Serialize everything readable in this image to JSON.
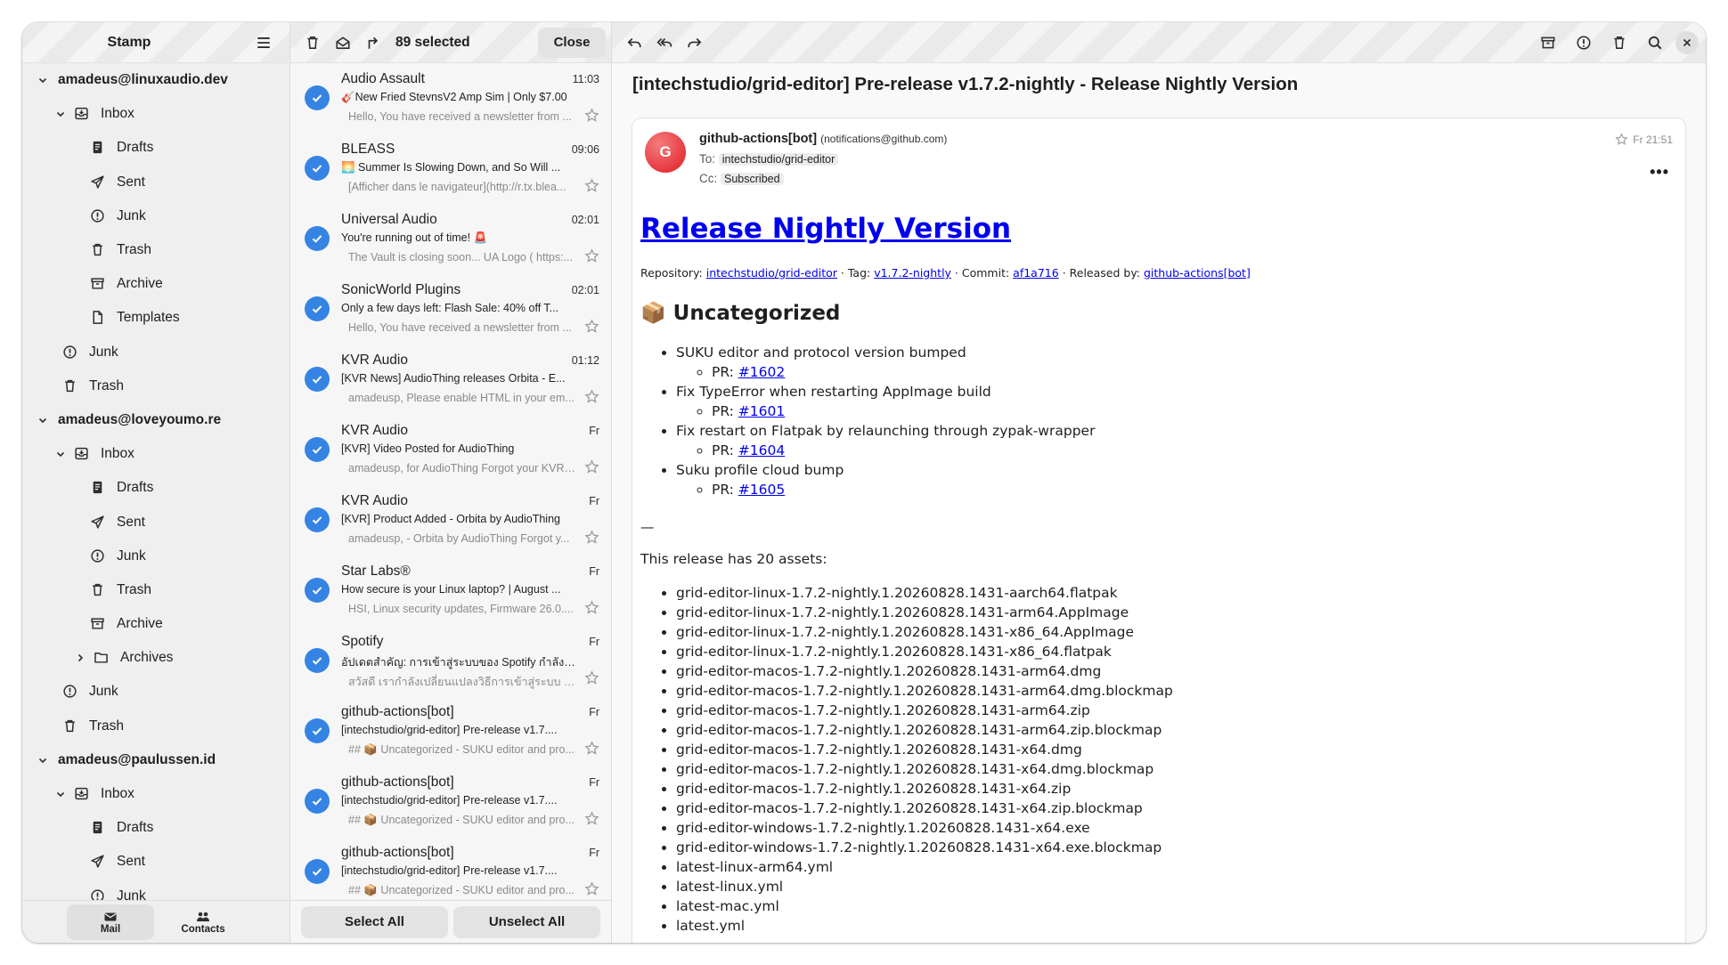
{
  "sidebar": {
    "title": "Stamp",
    "accounts": [
      {
        "name": "amadeus@linuxaudio.dev",
        "inbox_label": "Inbox",
        "subfolders": [
          "Drafts",
          "Sent",
          "Junk",
          "Trash",
          "Archive",
          "Templates"
        ],
        "extra_folders": [
          "Junk",
          "Trash"
        ]
      },
      {
        "name": "amadeus@loveyoumo.re",
        "inbox_label": "Inbox",
        "subfolders": [
          "Drafts",
          "Sent",
          "Junk",
          "Trash",
          "Archive",
          "Archives"
        ],
        "extra_folders": [
          "Junk",
          "Trash"
        ]
      },
      {
        "name": "amadeus@paulussen.id",
        "inbox_label": "Inbox",
        "subfolders": [
          "Drafts",
          "Sent",
          "Junk"
        ]
      }
    ],
    "tabs": {
      "mail": "Mail",
      "contacts": "Contacts"
    }
  },
  "list": {
    "selected_count": "89 selected",
    "close_label": "Close",
    "select_all": "Select All",
    "unselect_all": "Unselect All",
    "messages": [
      {
        "sender": "Audio Assault",
        "time": "11:03",
        "subject": "🎸New Fried StevnsV2 Amp Sim | Only $7.00",
        "preview": "Hello, You have received a newsletter from ..."
      },
      {
        "sender": "BLEASS",
        "time": "09:06",
        "subject": "🌅 Summer Is Slowing Down, and So Will ...",
        "preview": "[Afficher dans le navigateur](http://r.tx.blea..."
      },
      {
        "sender": "Universal Audio",
        "time": "02:01",
        "subject": "You're running out of time! 🚨",
        "preview": "The Vault is closing soon... UA Logo ( https:..."
      },
      {
        "sender": "SonicWorld Plugins",
        "time": "02:01",
        "subject": "Only a few days left: Flash Sale: 40% off T...",
        "preview": "Hello, You have received a newsletter from ..."
      },
      {
        "sender": "KVR Audio",
        "time": "01:12",
        "subject": "[KVR News] AudioThing releases Orbita - E...",
        "preview": "amadeusp, Please enable HTML in your em..."
      },
      {
        "sender": "KVR Audio",
        "time": "Fr",
        "subject": "[KVR] Video Posted for AudioThing",
        "preview": "amadeusp, for AudioThing Forgot your KVR ..."
      },
      {
        "sender": "KVR Audio",
        "time": "Fr",
        "subject": "[KVR] Product Added - Orbita by AudioThing",
        "preview": "amadeusp, - Orbita by AudioThing Forgot y..."
      },
      {
        "sender": "Star Labs®",
        "time": "Fr",
        "subject": "How secure is your Linux laptop? | August ...",
        "preview": "HSI, Linux security updates, Firmware 26.0...."
      },
      {
        "sender": "Spotify",
        "time": "Fr",
        "subject": "อัปเดตสำคัญ: การเข้าสู่ระบบของ Spotify กำลังมีการ...",
        "preview": "สวัสดี เรากำลังเปลี่ยนแปลงวิธีการเข้าสู่ระบบ Spotify..."
      },
      {
        "sender": "github-actions[bot]",
        "time": "Fr",
        "subject": "[intechstudio/grid-editor] Pre-release v1.7....",
        "preview": "## 📦 Uncategorized - SUKU editor and pro..."
      },
      {
        "sender": "github-actions[bot]",
        "time": "Fr",
        "subject": "[intechstudio/grid-editor] Pre-release v1.7....",
        "preview": "## 📦 Uncategorized - SUKU editor and pro..."
      },
      {
        "sender": "github-actions[bot]",
        "time": "Fr",
        "subject": "[intechstudio/grid-editor] Pre-release v1.7....",
        "preview": "## 📦 Uncategorized - SUKU editor and pro..."
      }
    ]
  },
  "reader": {
    "subject": "[intechstudio/grid-editor] Pre-release v1.7.2-nightly - Release Nightly Version",
    "avatar_letter": "G",
    "from_name": "github-actions[bot]",
    "from_addr": "(notifications@github.com)",
    "to_label": "To:",
    "to_value": "intechstudio/grid-editor",
    "cc_label": "Cc:",
    "cc_value": "Subscribed",
    "date": "Fr 21:51",
    "more": "•••",
    "body": {
      "heading": "Release Nightly Version",
      "meta_repo_label": "Repository: ",
      "meta_repo": "intechstudio/grid-editor",
      "meta_tag_label": " · Tag: ",
      "meta_tag": "v1.7.2-nightly",
      "meta_commit_label": " · Commit: ",
      "meta_commit": "af1a716",
      "meta_released_label": " · Released by: ",
      "meta_released": "github-actions[bot]",
      "section_emoji": "📦",
      "section_title": "Uncategorized",
      "changes": [
        {
          "text": "SUKU editor and protocol version bumped",
          "pr_label": "PR: ",
          "pr": "#1602"
        },
        {
          "text": "Fix TypeError when restarting AppImage build",
          "pr_label": "PR: ",
          "pr": "#1601"
        },
        {
          "text": "Fix restart on Flatpak by relaunching through zypak-wrapper",
          "pr_label": "PR: ",
          "pr": "#1604"
        },
        {
          "text": "Suku profile cloud bump",
          "pr_label": "PR: ",
          "pr": "#1605"
        }
      ],
      "dash": "—",
      "assets_intro": "This release has 20 assets:",
      "assets": [
        "grid-editor-linux-1.7.2-nightly.1.20260828.1431-aarch64.flatpak",
        "grid-editor-linux-1.7.2-nightly.1.20260828.1431-arm64.AppImage",
        "grid-editor-linux-1.7.2-nightly.1.20260828.1431-x86_64.AppImage",
        "grid-editor-linux-1.7.2-nightly.1.20260828.1431-x86_64.flatpak",
        "grid-editor-macos-1.7.2-nightly.1.20260828.1431-arm64.dmg",
        "grid-editor-macos-1.7.2-nightly.1.20260828.1431-arm64.dmg.blockmap",
        "grid-editor-macos-1.7.2-nightly.1.20260828.1431-arm64.zip",
        "grid-editor-macos-1.7.2-nightly.1.20260828.1431-arm64.zip.blockmap",
        "grid-editor-macos-1.7.2-nightly.1.20260828.1431-x64.dmg",
        "grid-editor-macos-1.7.2-nightly.1.20260828.1431-x64.dmg.blockmap",
        "grid-editor-macos-1.7.2-nightly.1.20260828.1431-x64.zip",
        "grid-editor-macos-1.7.2-nightly.1.20260828.1431-x64.zip.blockmap",
        "grid-editor-windows-1.7.2-nightly.1.20260828.1431-x64.exe",
        "grid-editor-windows-1.7.2-nightly.1.20260828.1431-x64.exe.blockmap",
        "latest-linux-arm64.yml",
        "latest-linux.yml",
        "latest-mac.yml",
        "latest.yml"
      ]
    }
  },
  "colors": {
    "accent": "#3584e4",
    "link": "#0000ee",
    "avatar": "#e01b24"
  }
}
